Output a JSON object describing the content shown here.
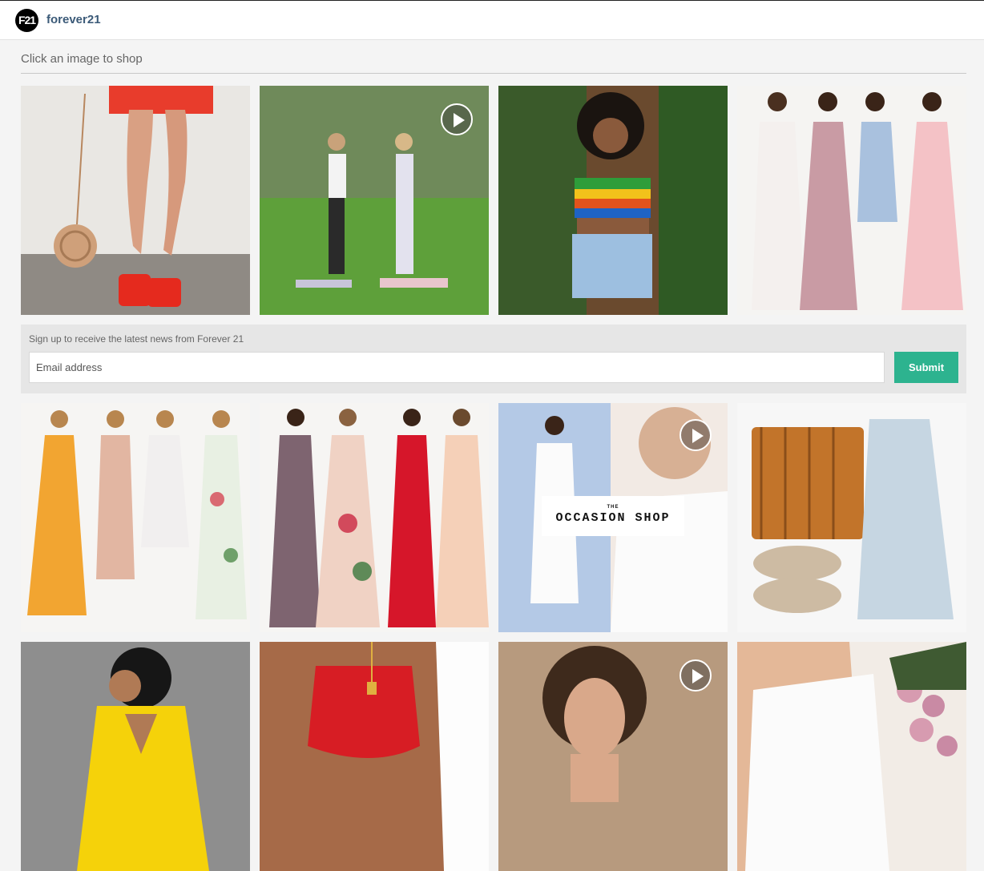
{
  "header": {
    "logo_text": "F21",
    "brand_name": "forever21"
  },
  "gallery": {
    "heading": "Click an image to shop",
    "tiles": [
      {
        "name": "red-heels-straw-bag",
        "video": false
      },
      {
        "name": "yoga-pose-park",
        "video": true
      },
      {
        "name": "rainbow-crop-top",
        "video": false
      },
      {
        "name": "four-maxi-dresses",
        "video": false
      },
      {
        "name": "four-summer-dresses",
        "video": false
      },
      {
        "name": "four-gowns",
        "video": false
      },
      {
        "name": "occasion-shop",
        "video": true
      },
      {
        "name": "flatlay-outfit",
        "video": false
      },
      {
        "name": "yellow-dress",
        "video": false
      },
      {
        "name": "red-bikini-top",
        "video": false
      },
      {
        "name": "portrait-woman",
        "video": true
      },
      {
        "name": "white-top-flowers",
        "video": false
      }
    ]
  },
  "signup": {
    "label": "Sign up to receive the latest news from Forever 21",
    "email_placeholder": "Email address",
    "email_value": "",
    "submit_label": "Submit"
  },
  "occasion": {
    "the": "THE",
    "title": "OCCASION SHOP"
  },
  "colors": {
    "accent": "#2db38f",
    "brand_text": "#3b5a78"
  },
  "icons": [
    "play-icon"
  ]
}
